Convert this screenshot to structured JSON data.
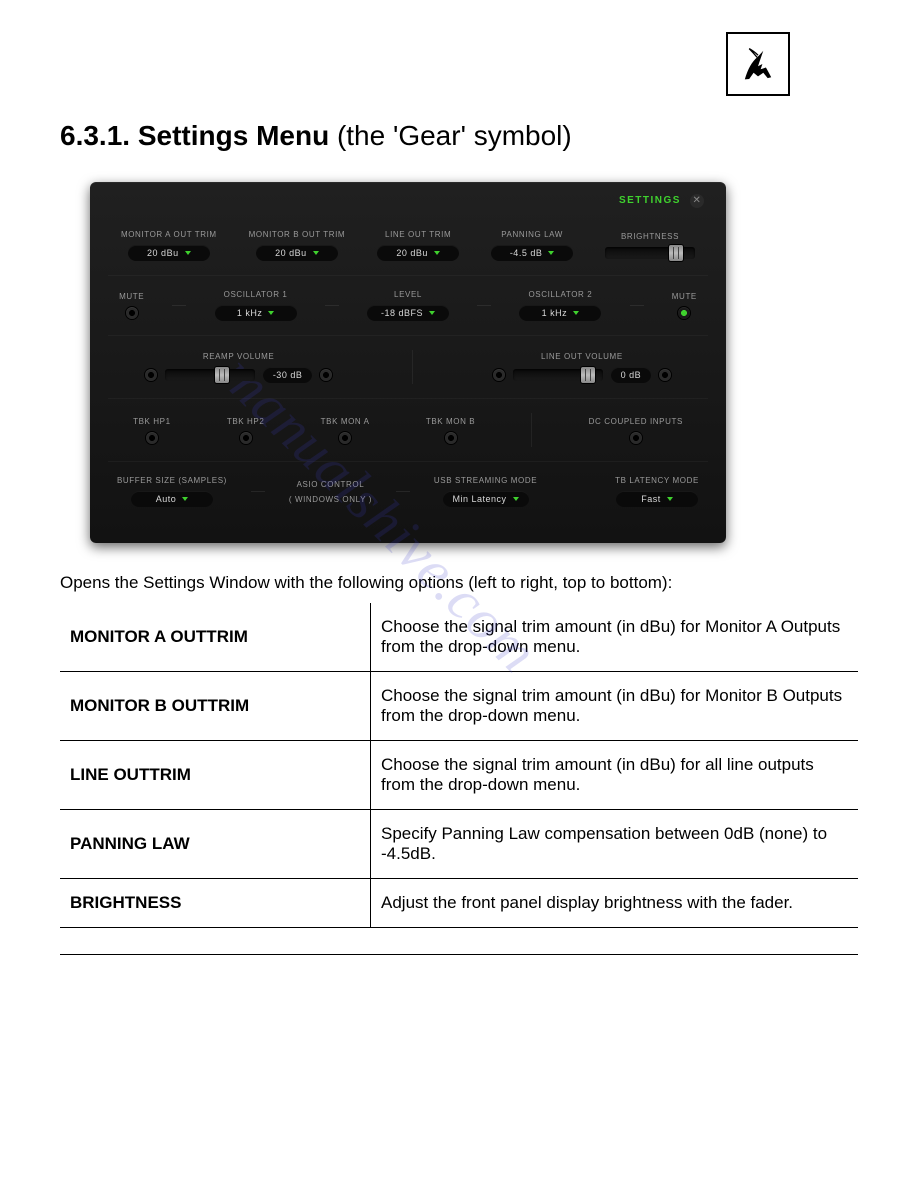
{
  "heading_number": "6.3.1. Settings Menu",
  "heading_suffix": " (the 'Gear' symbol)",
  "watermark": "manualshive.com",
  "panel": {
    "title": "SETTINGS",
    "row1": {
      "monitor_a_label": "MONITOR A OUT TRIM",
      "monitor_a_value": "20 dBu",
      "monitor_b_label": "MONITOR B OUT TRIM",
      "monitor_b_value": "20 dBu",
      "line_out_label": "LINE OUT TRIM",
      "line_out_value": "20 dBu",
      "panning_label": "PANNING LAW",
      "panning_value": "-4.5 dB",
      "brightness_label": "BRIGHTNESS"
    },
    "row2": {
      "mute1_label": "MUTE",
      "osc1_label": "OSCILLATOR 1",
      "osc1_value": "1 kHz",
      "level_label": "LEVEL",
      "level_value": "-18 dBFS",
      "osc2_label": "OSCILLATOR 2",
      "osc2_value": "1 kHz",
      "mute2_label": "MUTE"
    },
    "row3": {
      "reamp_label": "REAMP VOLUME",
      "reamp_value": "-30 dB",
      "lineout_label": "LINE OUT VOLUME",
      "lineout_value": "0 dB"
    },
    "row4": {
      "hp1": "TBK HP1",
      "hp2": "TBK HP2",
      "mona": "TBK MON A",
      "monb": "TBK MON B",
      "dc": "DC COUPLED INPUTS"
    },
    "row5": {
      "buffer_label": "BUFFER SIZE (SAMPLES)",
      "buffer_value": "Auto",
      "asio_label1": "ASIO CONTROL",
      "asio_label2": "( WINDOWS ONLY )",
      "usb_label": "USB STREAMING MODE",
      "usb_value": "Min Latency",
      "tb_label": "TB LATENCY MODE",
      "tb_value": "Fast"
    }
  },
  "intro": "Opens the Settings Window with the following options (left to right, top to bottom):",
  "options": [
    {
      "name": "MONITOR A OUTTRIM",
      "desc": "Choose the signal trim amount (in dBu) for Monitor A Outputs from the drop-down menu."
    },
    {
      "name": "MONITOR B OUTTRIM",
      "desc": "Choose the signal trim amount (in dBu) for Monitor B Outputs from the drop-down menu."
    },
    {
      "name": "LINE OUTTRIM",
      "desc": "Choose the signal trim amount (in dBu) for all line outputs from the drop-down menu."
    },
    {
      "name": "PANNING LAW",
      "desc": "Specify Panning Law compensation between 0dB (none) to -4.5dB."
    },
    {
      "name": "BRIGHTNESS",
      "desc": "Adjust the front panel display brightness with the fader."
    }
  ]
}
